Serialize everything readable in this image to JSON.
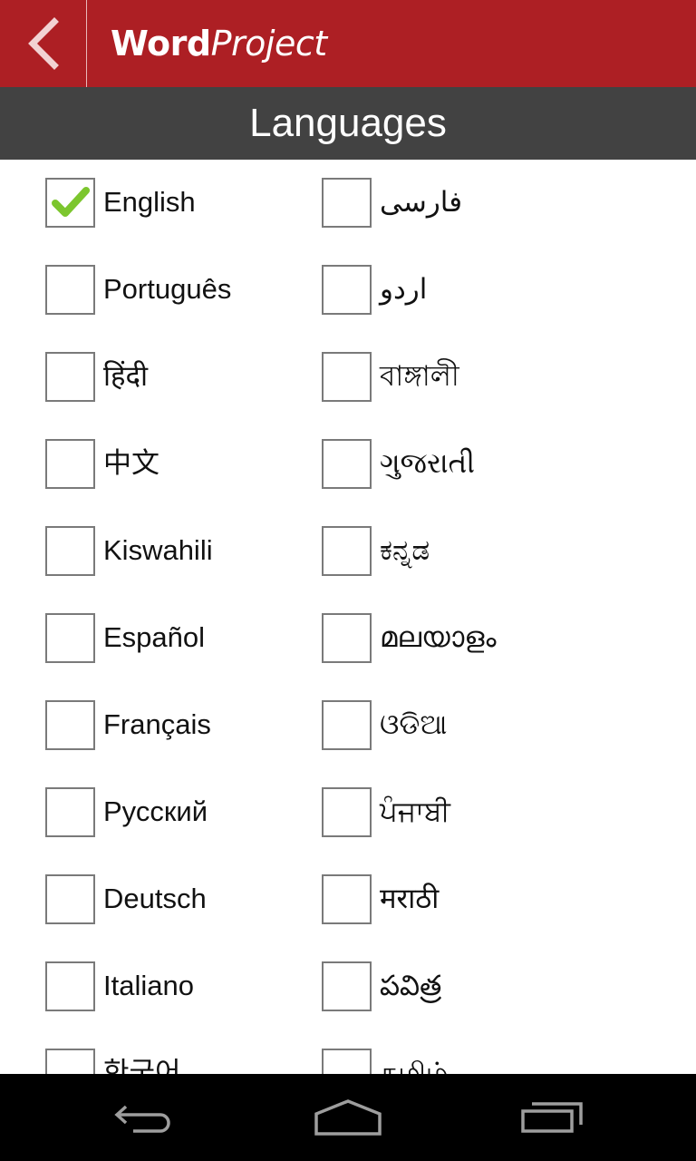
{
  "header": {
    "back_icon": "chevron-left-icon",
    "logo_bold": "Word",
    "logo_italic": "Project",
    "brand_color": "#ad1f24"
  },
  "title_bar": {
    "title": "Languages",
    "background": "#424242"
  },
  "languages": {
    "left": [
      {
        "label": "English",
        "checked": true
      },
      {
        "label": "Português",
        "checked": false
      },
      {
        "label": "हिंदी",
        "checked": false
      },
      {
        "label": "中文",
        "checked": false
      },
      {
        "label": "Kiswahili",
        "checked": false
      },
      {
        "label": "Español",
        "checked": false
      },
      {
        "label": "Français",
        "checked": false
      },
      {
        "label": "Русский",
        "checked": false
      },
      {
        "label": "Deutsch",
        "checked": false
      },
      {
        "label": "Italiano",
        "checked": false
      },
      {
        "label": "한국어",
        "checked": false
      }
    ],
    "right": [
      {
        "label": "فارسی",
        "checked": false
      },
      {
        "label": "اردو",
        "checked": false
      },
      {
        "label": "বাঙ্গালী",
        "checked": false
      },
      {
        "label": "ગુજરાતી",
        "checked": false
      },
      {
        "label": "ಕನ್ನಡ",
        "checked": false
      },
      {
        "label": "മലയാളം",
        "checked": false
      },
      {
        "label": "ଓଡିଆ",
        "checked": false
      },
      {
        "label": "ਪੰਜਾਬੀ",
        "checked": false
      },
      {
        "label": "मराठी",
        "checked": false
      },
      {
        "label": "పవిత్ర",
        "checked": false
      },
      {
        "label": "தமிழ்",
        "checked": false
      }
    ],
    "check_color": "#7cc62e"
  },
  "nav_bar": {
    "back_icon": "back-arrow-icon",
    "home_icon": "home-icon",
    "recents_icon": "recent-apps-icon"
  }
}
